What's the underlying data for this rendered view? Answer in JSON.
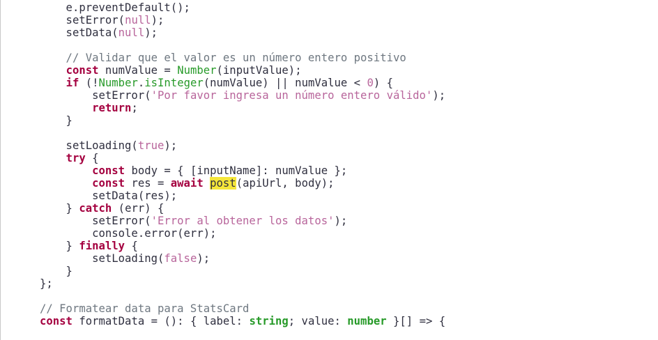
{
  "editor": {
    "language": "typescript",
    "lines": [
      [
        {
          "t": "    e.preventDefault();",
          "k": "pln"
        }
      ],
      [
        {
          "t": "    setError(",
          "k": "pln"
        },
        {
          "t": "null",
          "k": "lit"
        },
        {
          "t": ");",
          "k": "pln"
        }
      ],
      [
        {
          "t": "    setData(",
          "k": "pln"
        },
        {
          "t": "null",
          "k": "lit"
        },
        {
          "t": ");",
          "k": "pln"
        }
      ],
      [],
      [
        {
          "t": "    // Validar que el valor es un número entero positivo",
          "k": "cmt"
        }
      ],
      [
        {
          "t": "    ",
          "k": "pln"
        },
        {
          "t": "const",
          "k": "kw"
        },
        {
          "t": " numValue = ",
          "k": "pln"
        },
        {
          "t": "Number",
          "k": "bi"
        },
        {
          "t": "(inputValue);",
          "k": "pln"
        }
      ],
      [
        {
          "t": "    ",
          "k": "pln"
        },
        {
          "t": "if",
          "k": "kw"
        },
        {
          "t": " (!",
          "k": "pln"
        },
        {
          "t": "Number",
          "k": "bi"
        },
        {
          "t": ".",
          "k": "pln"
        },
        {
          "t": "isInteger",
          "k": "bi"
        },
        {
          "t": "(numValue) || numValue < ",
          "k": "pln"
        },
        {
          "t": "0",
          "k": "lit"
        },
        {
          "t": ") {",
          "k": "pln"
        }
      ],
      [
        {
          "t": "        setError(",
          "k": "pln"
        },
        {
          "t": "'Por favor ingresa un número entero válido'",
          "k": "str"
        },
        {
          "t": ");",
          "k": "pln"
        }
      ],
      [
        {
          "t": "        ",
          "k": "pln"
        },
        {
          "t": "return",
          "k": "kw"
        },
        {
          "t": ";",
          "k": "pln"
        }
      ],
      [
        {
          "t": "    }",
          "k": "pln"
        }
      ],
      [],
      [
        {
          "t": "    setLoading(",
          "k": "pln"
        },
        {
          "t": "true",
          "k": "lit"
        },
        {
          "t": ");",
          "k": "pln"
        }
      ],
      [
        {
          "t": "    ",
          "k": "pln"
        },
        {
          "t": "try",
          "k": "kw"
        },
        {
          "t": " {",
          "k": "pln"
        }
      ],
      [
        {
          "t": "        ",
          "k": "pln"
        },
        {
          "t": "const",
          "k": "kw"
        },
        {
          "t": " body = { [inputName]: numValue };",
          "k": "pln"
        }
      ],
      [
        {
          "t": "        ",
          "k": "pln"
        },
        {
          "t": "const",
          "k": "kw"
        },
        {
          "t": " res = ",
          "k": "pln"
        },
        {
          "t": "await",
          "k": "kw"
        },
        {
          "t": " ",
          "k": "pln"
        },
        {
          "t": "post",
          "k": "hl"
        },
        {
          "t": "(apiUrl, body);",
          "k": "pln"
        }
      ],
      [
        {
          "t": "        setData(res);",
          "k": "pln"
        }
      ],
      [
        {
          "t": "    } ",
          "k": "pln"
        },
        {
          "t": "catch",
          "k": "kw"
        },
        {
          "t": " (err) {",
          "k": "pln"
        }
      ],
      [
        {
          "t": "        setError(",
          "k": "pln"
        },
        {
          "t": "'Error al obtener los datos'",
          "k": "str"
        },
        {
          "t": ");",
          "k": "pln"
        }
      ],
      [
        {
          "t": "        console.error(err);",
          "k": "pln"
        }
      ],
      [
        {
          "t": "    } ",
          "k": "pln"
        },
        {
          "t": "finally",
          "k": "kw"
        },
        {
          "t": " {",
          "k": "pln"
        }
      ],
      [
        {
          "t": "        setLoading(",
          "k": "pln"
        },
        {
          "t": "false",
          "k": "lit"
        },
        {
          "t": ");",
          "k": "pln"
        }
      ],
      [
        {
          "t": "    }",
          "k": "pln"
        }
      ],
      [
        {
          "t": "};",
          "k": "pln"
        }
      ],
      [],
      [
        {
          "t": "// Formatear data para StatsCard",
          "k": "cmt"
        }
      ],
      [
        {
          "t": "const",
          "k": "kw"
        },
        {
          "t": " formatData = (): { label: ",
          "k": "pln"
        },
        {
          "t": "string",
          "k": "type"
        },
        {
          "t": "; value: ",
          "k": "pln"
        },
        {
          "t": "number",
          "k": "type"
        },
        {
          "t": " }[] => {",
          "k": "pln"
        }
      ]
    ]
  }
}
